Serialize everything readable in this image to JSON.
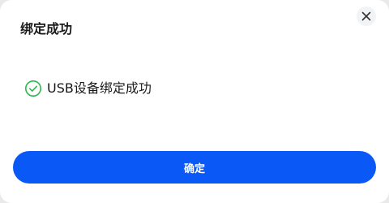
{
  "dialog": {
    "title": "绑定成功",
    "close_icon": "close-icon",
    "message": {
      "icon": "check-circle-icon",
      "icon_color": "#2db84c",
      "text": "USB设备绑定成功"
    },
    "confirm_label": "确定",
    "accent_color": "#0a59f7"
  }
}
